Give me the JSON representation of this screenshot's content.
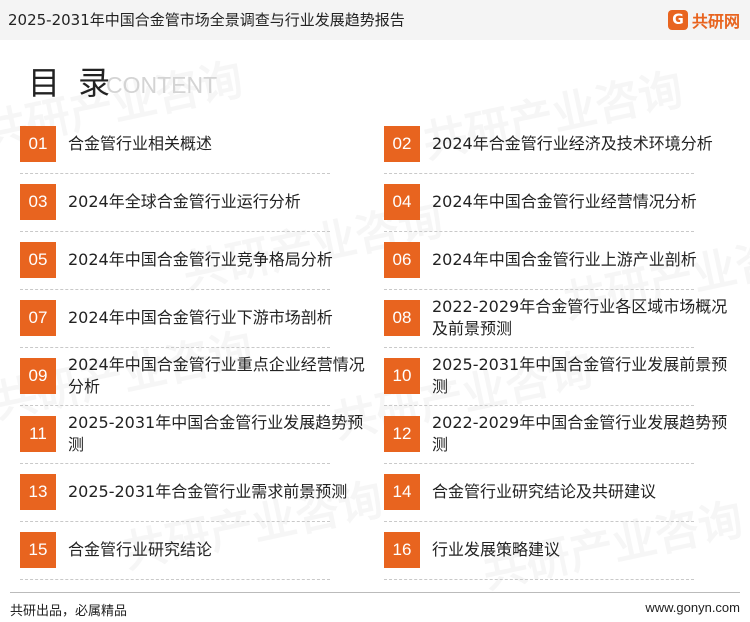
{
  "header": {
    "title": "2025-2031年中国合金管市场全景调查与行业发展趋势报告",
    "brand_mark": "G",
    "brand_name": "共研网"
  },
  "heading": {
    "title": "目 录",
    "subtitle_en": "CONTENT"
  },
  "toc": {
    "items": [
      {
        "num": "01",
        "label": "合金管行业相关概述"
      },
      {
        "num": "02",
        "label": "2024年合金管行业经济及技术环境分析"
      },
      {
        "num": "03",
        "label": "2024年全球合金管行业运行分析"
      },
      {
        "num": "04",
        "label": "2024年中国合金管行业经营情况分析"
      },
      {
        "num": "05",
        "label": "2024年中国合金管行业竞争格局分析"
      },
      {
        "num": "06",
        "label": "2024年中国合金管行业上游产业剖析"
      },
      {
        "num": "07",
        "label": "2024年中国合金管行业下游市场剖析"
      },
      {
        "num": "08",
        "label": "2022-2029年合金管行业各区域市场概况及前景预测"
      },
      {
        "num": "09",
        "label": "2024年中国合金管行业重点企业经营情况分析"
      },
      {
        "num": "10",
        "label": "2025-2031年中国合金管行业发展前景预测"
      },
      {
        "num": "11",
        "label": "2025-2031年中国合金管行业发展趋势预测"
      },
      {
        "num": "12",
        "label": "2022-2029年中国合金管行业发展趋势预测"
      },
      {
        "num": "13",
        "label": "2025-2031年合金管行业需求前景预测"
      },
      {
        "num": "14",
        "label": "合金管行业研究结论及共研建议"
      },
      {
        "num": "15",
        "label": "合金管行业研究结论"
      },
      {
        "num": "16",
        "label": "行业发展策略建议"
      }
    ]
  },
  "footer": {
    "slogan": "共研出品，必属精品",
    "url": "www.gonyn.com"
  },
  "watermark": {
    "text": "共研产业咨询",
    "url": "www.gonyn.com"
  },
  "colors": {
    "accent": "#e8641f",
    "topbar": "#f4f4f4"
  }
}
